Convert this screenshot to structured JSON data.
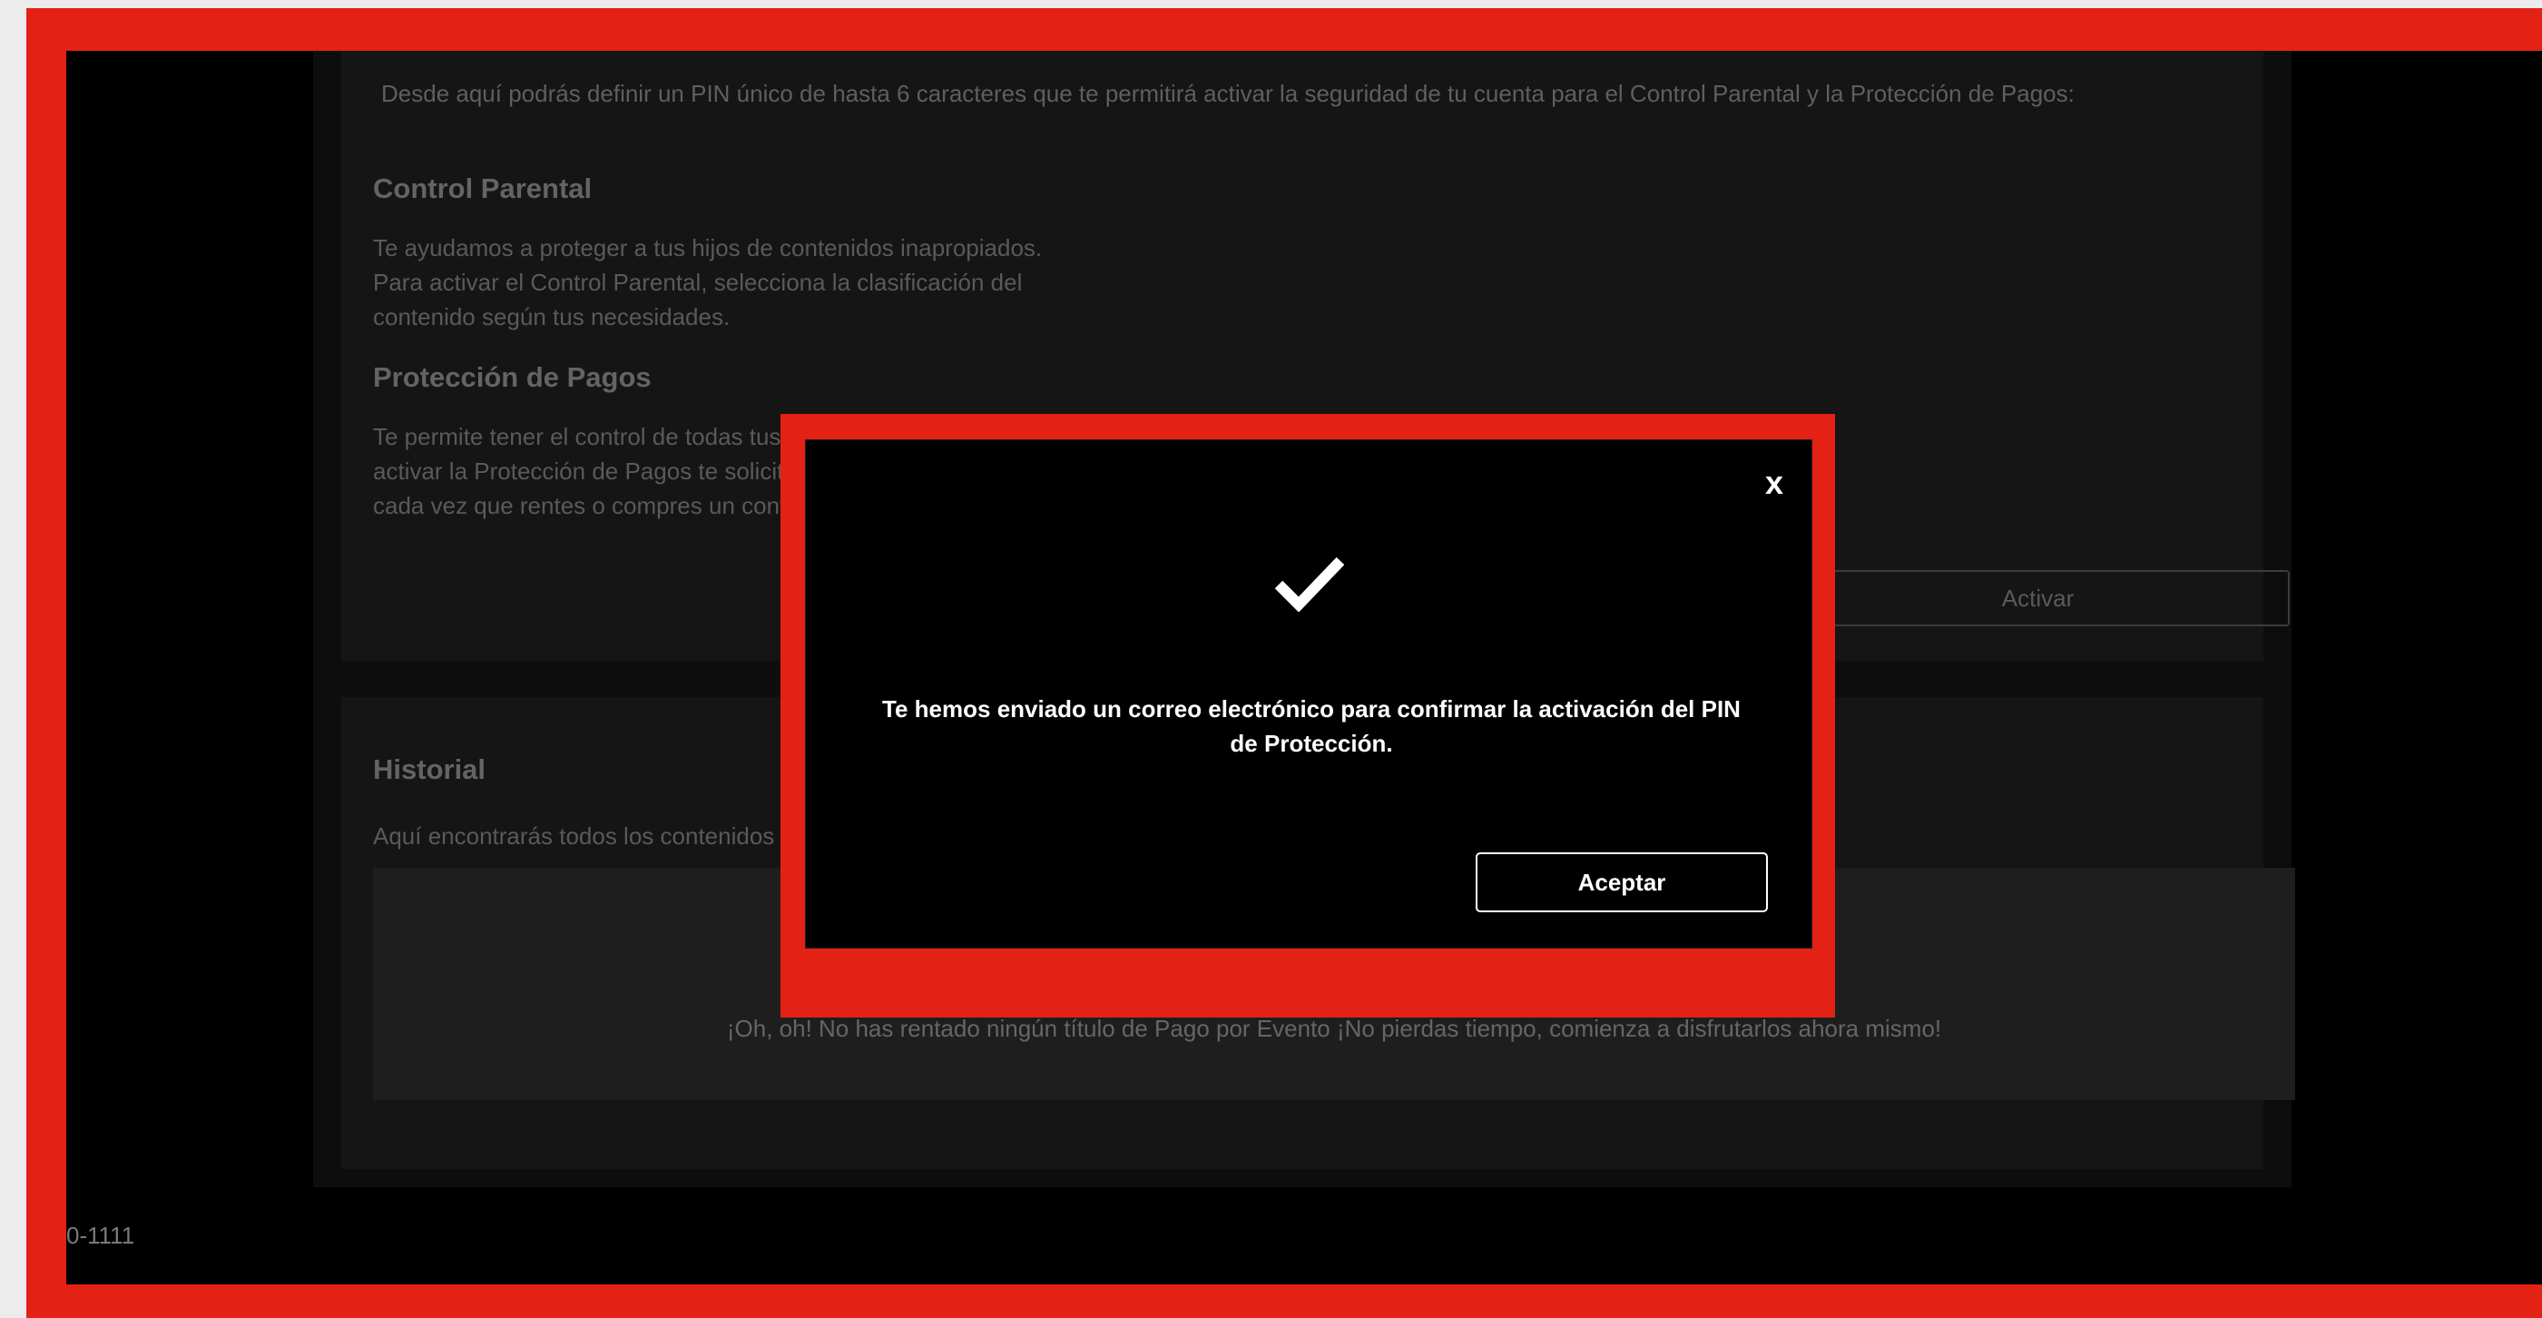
{
  "security": {
    "intro": "Desde aquí podrás definir un PIN único de hasta 6 caracteres que te permitirá activar la seguridad de tu cuenta para el Control Parental y la Protección de Pagos:",
    "parental_title": "Control Parental",
    "parental_desc": "Te ayudamos a proteger a tus hijos de contenidos inapropiados.\nPara activar el Control Parental, selecciona la clasificación del\ncontenido según tus necesidades.",
    "payments_title": "Protección de Pagos",
    "payments_desc": "Te permite tener el control de todas tus rentas y compras. Para\nactivar la Protección de Pagos te solicitaremos tu PIN de Seguridad\ncada vez que rentes o compres un contenido.",
    "activate_label": "Activar"
  },
  "history": {
    "title": "Historial",
    "desc": "Aquí encontrarás todos los contenidos que has rentado",
    "empty_message": "¡Oh, oh! No has rentado ningún título de Pago por Evento ¡No pierdas tiempo, comienza a disfrutarlos ahora mismo!"
  },
  "footer": {
    "phone_partial": "0-1111"
  },
  "modal": {
    "close_label": "x",
    "message": "Te hemos enviado un correo electrónico para confirmar la activación del PIN de Protección.",
    "accept_label": "Aceptar",
    "icon": "checkmark-icon"
  }
}
